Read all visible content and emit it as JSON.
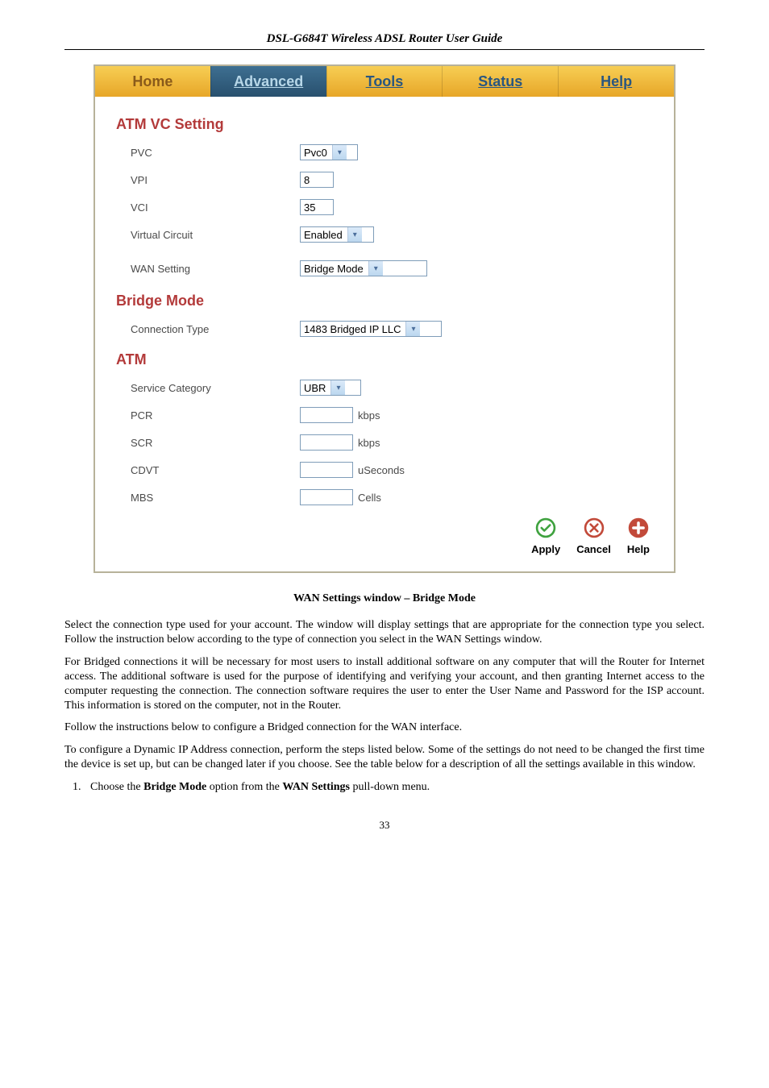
{
  "doc": {
    "title": "DSL-G684T Wireless ADSL Router User Guide",
    "caption": "WAN Settings window – Bridge Mode",
    "p1": "Select the connection type used for your account. The window will display settings that are appropriate for the connection type you select. Follow the instruction below according to the type of connection you select in the WAN Settings window.",
    "p2": "For Bridged connections it will be necessary for most users to install additional software on any computer that will the Router for Internet access. The additional software is used for the purpose of identifying and verifying your account, and then granting Internet access to the computer requesting the connection. The connection software requires the user to enter the User Name and Password for the ISP account. This information is stored on the computer, not in the Router.",
    "p3": "Follow the instructions below to configure a Bridged connection for the WAN interface.",
    "p4": "To configure a Dynamic IP Address connection, perform the steps listed below. Some of the settings do not need to be changed the first time the device is set up, but can be changed later if you choose. See the table below for a description of all the settings available in this window.",
    "step1_pre": "Choose the ",
    "step1_b1": "Bridge Mode",
    "step1_mid": " option from the ",
    "step1_b2": "WAN Settings",
    "step1_post": " pull-down menu.",
    "pagenum": "33"
  },
  "tabs": {
    "home": "Home",
    "advanced": "Advanced",
    "tools": "Tools",
    "status": "Status",
    "help": "Help"
  },
  "sections": {
    "atm_vc": "ATM VC Setting",
    "bridge": "Bridge Mode",
    "atm": "ATM"
  },
  "fields": {
    "pvc_label": "PVC",
    "pvc_value": "Pvc0",
    "vpi_label": "VPI",
    "vpi_value": "8",
    "vci_label": "VCI",
    "vci_value": "35",
    "vcircuit_label": "Virtual Circuit",
    "vcircuit_value": "Enabled",
    "wan_label": "WAN Setting",
    "wan_value": "Bridge Mode",
    "conn_label": "Connection Type",
    "conn_value": "1483 Bridged IP LLC",
    "svc_label": "Service Category",
    "svc_value": "UBR",
    "pcr_label": "PCR",
    "pcr_unit": "kbps",
    "scr_label": "SCR",
    "scr_unit": "kbps",
    "cdvt_label": "CDVT",
    "cdvt_unit": "uSeconds",
    "mbs_label": "MBS",
    "mbs_unit": "Cells"
  },
  "actions": {
    "apply": "Apply",
    "cancel": "Cancel",
    "help": "Help"
  }
}
